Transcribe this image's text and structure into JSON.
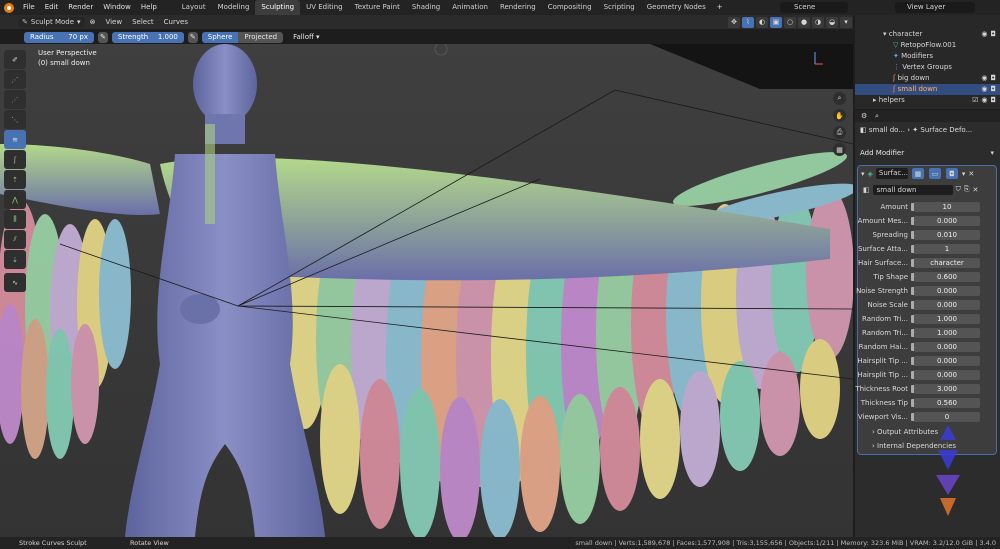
{
  "menu": [
    "File",
    "Edit",
    "Render",
    "Window",
    "Help"
  ],
  "workspaces": [
    "Layout",
    "Modeling",
    "Sculpting",
    "UV Editing",
    "Texture Paint",
    "Shading",
    "Animation",
    "Rendering",
    "Compositing",
    "Scripting",
    "Geometry Nodes"
  ],
  "active_workspace": "Sculpting",
  "scene": "Scene",
  "view_layer": "View Layer",
  "header": {
    "mode": "Sculpt Mode",
    "view": "View",
    "select": "Select",
    "curves": "Curves",
    "xyz": [
      "X",
      "Y",
      "Z"
    ]
  },
  "tool_settings": {
    "radius_label": "Radius",
    "radius_value": "70 px",
    "strength_label": "Strength",
    "strength_value": "1.000",
    "sphere": "Sphere",
    "projected": "Projected",
    "falloff": "Falloff"
  },
  "viewport": {
    "perspective": "User Perspective",
    "object": "(0) small down"
  },
  "outliner": {
    "rows": [
      {
        "label": "character",
        "level": 1
      },
      {
        "label": "RetopoFlow.001",
        "level": 2
      },
      {
        "label": "Modifiers",
        "level": 2
      },
      {
        "label": "Vertex Groups",
        "level": 2
      },
      {
        "label": "big down",
        "level": 2
      },
      {
        "label": "small down",
        "level": 2,
        "selected": true
      },
      {
        "label": "helpers",
        "level": 0
      }
    ]
  },
  "properties": {
    "breadcrumb_object": "small do...",
    "breadcrumb_modifier": "Surface Defo...",
    "add_modifier": "Add Modifier",
    "modifier_name": "Surfac...",
    "node_group": "small down",
    "params": [
      {
        "label": "Amount",
        "value": "10"
      },
      {
        "label": "Amount Mes...",
        "value": "0.000"
      },
      {
        "label": "Spreading",
        "value": "0.010"
      },
      {
        "label": "Surface Atta...",
        "value": "1"
      },
      {
        "label": "Hair Surface...",
        "value": "character"
      },
      {
        "label": "Tip Shape",
        "value": "0.600"
      },
      {
        "label": "Noise Strength",
        "value": "0.000"
      },
      {
        "label": "Noise Scale",
        "value": "0.000"
      },
      {
        "label": "Random Tri...",
        "value": "1.000"
      },
      {
        "label": "Random Tri...",
        "value": "1.000"
      },
      {
        "label": "Random Hai...",
        "value": "0.000"
      },
      {
        "label": "Hairsplit Tip ...",
        "value": "0.000"
      },
      {
        "label": "Hairsplit Tip ...",
        "value": "0.000"
      },
      {
        "label": "Thickness Root",
        "value": "3.000"
      },
      {
        "label": "Thickness Tip",
        "value": "0.560"
      },
      {
        "label": "Viewport Vis...",
        "value": "0"
      }
    ],
    "output_attributes": "Output Attributes",
    "internal_dependencies": "Internal Dependencies"
  },
  "status": {
    "left": "Stroke Curves Sculpt",
    "middle": "Rotate View",
    "right": "small down | Verts:1,589,678 | Faces:1,577,908 | Tris:3,155,656 | Objects:1/211 | Memory: 323.6 MiB | VRAM: 3.2/12.0 GiB | 3.4.0"
  },
  "colors": {
    "accent": "#4772b3",
    "selected_row": "#334d80",
    "blender_orange": "#e87d0d",
    "body": "#7c82b8",
    "hair": "#a9d07e"
  }
}
